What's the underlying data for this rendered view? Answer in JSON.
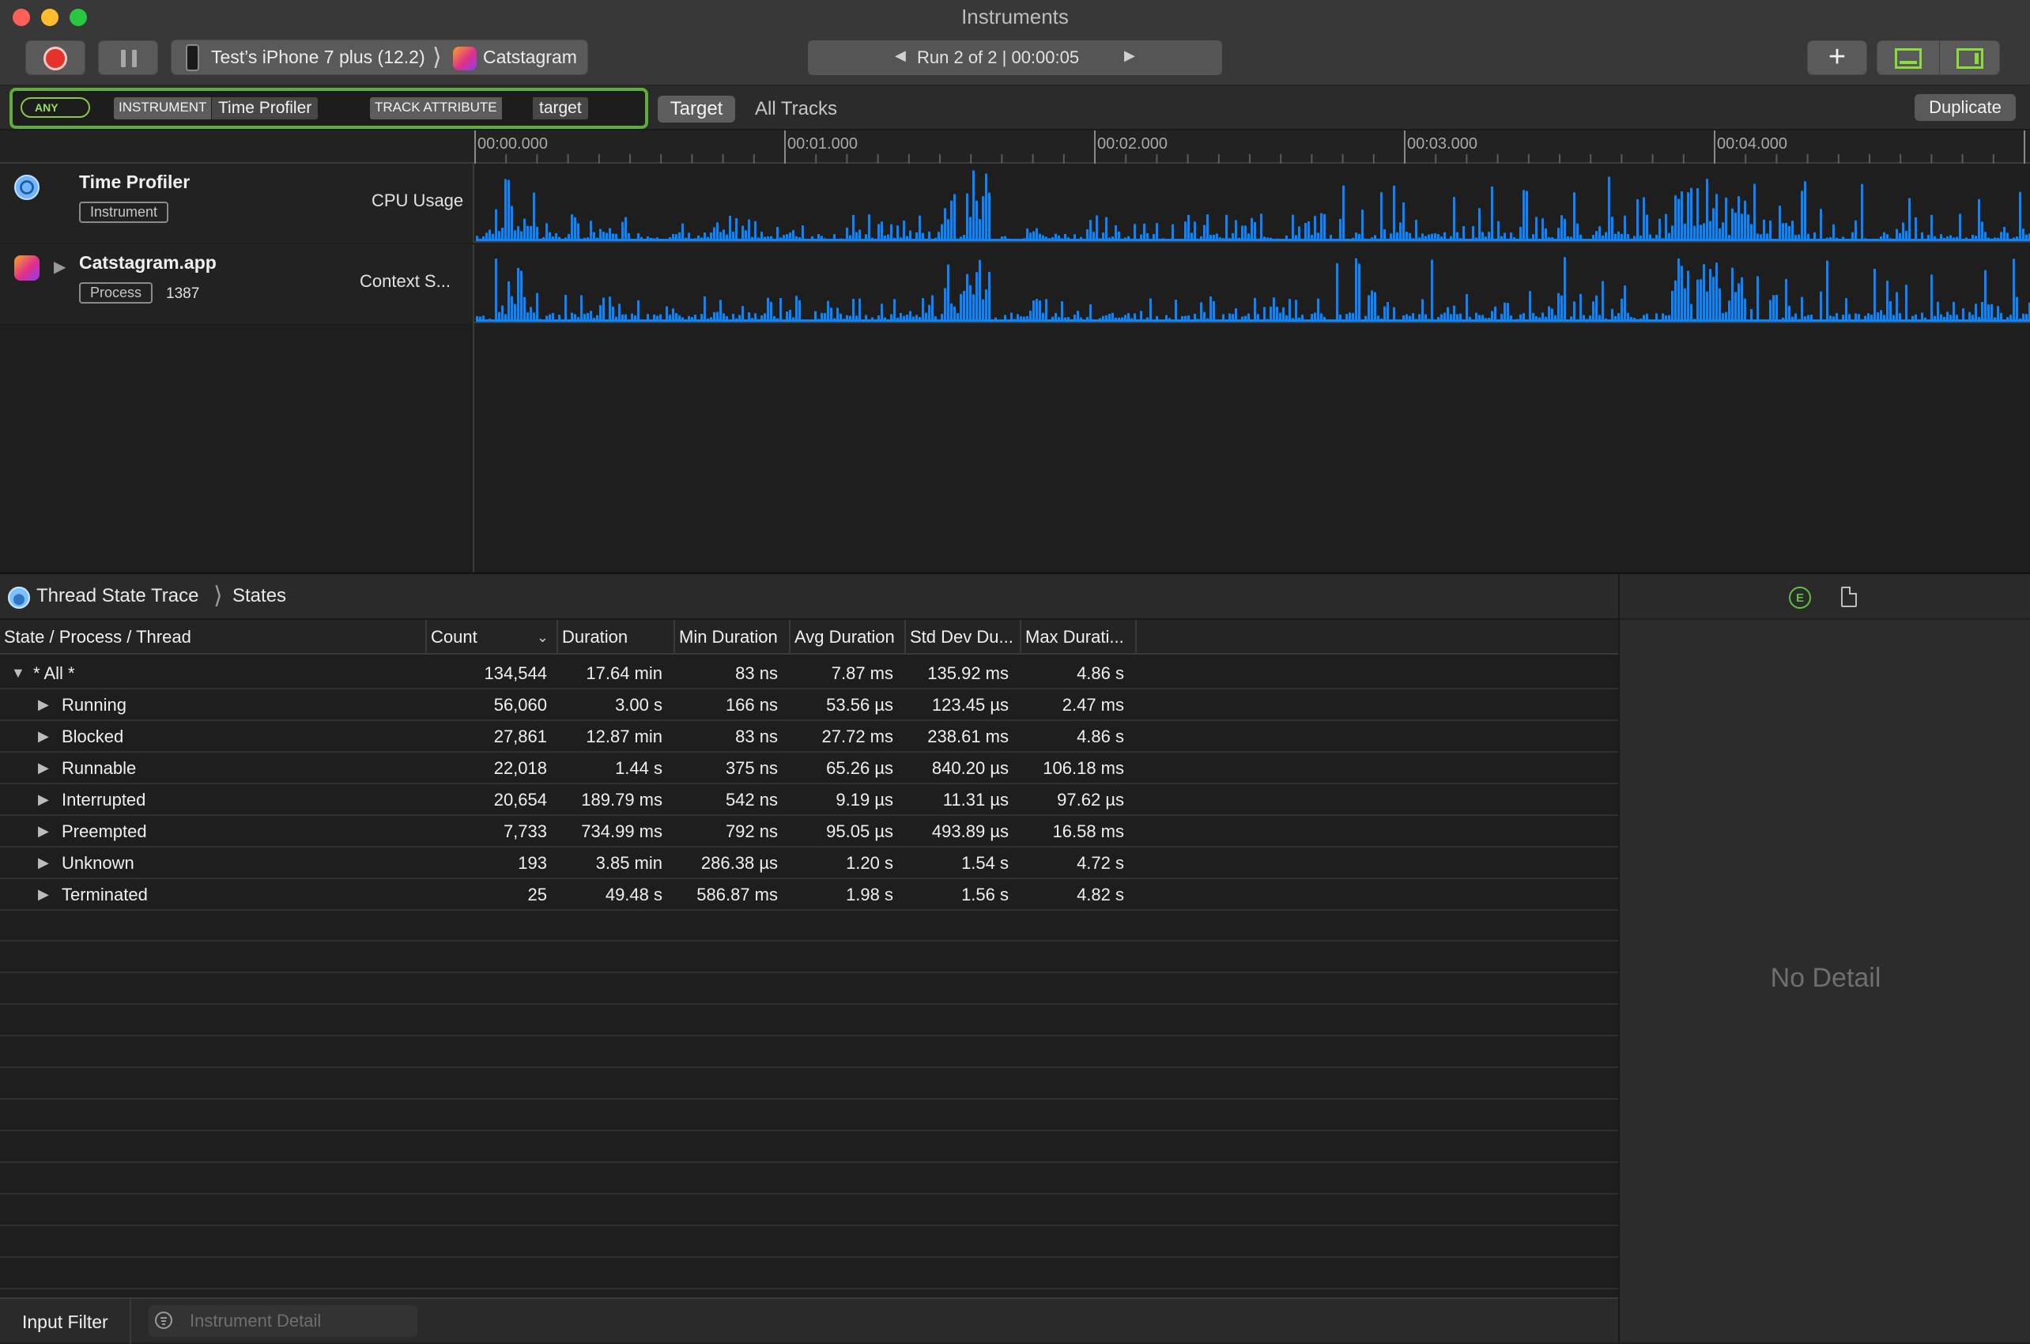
{
  "window": {
    "title": "Instruments"
  },
  "toolbar": {
    "device": "Test’s iPhone 7 plus (12.2)",
    "app": "Catstagram",
    "run_label": "Run 2 of 2  |  00:00:05",
    "icons": {
      "record": "record-stop-icon",
      "pause": "pause-icon",
      "add": "plus-icon",
      "view_bottom": "toggle-bottom-panel-icon",
      "view_right": "toggle-right-panel-icon"
    }
  },
  "filter": {
    "any_label": "ANY",
    "tokens": [
      {
        "key": "INSTRUMENT",
        "value": "Time Profiler"
      },
      {
        "key": "TRACK ATTRIBUTE",
        "value": "target"
      }
    ],
    "target_label": "Target",
    "all_tracks_label": "All Tracks",
    "duplicate_label": "Duplicate"
  },
  "timeline": {
    "ticks": [
      "00:00.000",
      "00:01.000",
      "00:02.000",
      "00:03.000",
      "00:04.000"
    ],
    "tracks": [
      {
        "title": "Time Profiler",
        "badge": "Instrument",
        "extra": "",
        "subtitle": "CPU Usage"
      },
      {
        "title": "Catstagram.app",
        "badge": "Process",
        "extra": "1387",
        "subtitle": "Context S..."
      }
    ],
    "accent_color": "#0a84ff"
  },
  "detail": {
    "instrument": "Thread State Trace",
    "view": "States",
    "columns": [
      "State / Process / Thread",
      "Count",
      "Duration",
      "Min Duration",
      "Avg Duration",
      "Std Dev Du...",
      "Max Durati..."
    ],
    "rows": [
      {
        "name": "* All *",
        "count": "134,544",
        "duration": "17.64 min",
        "min": "83 ns",
        "avg": "7.87 ms",
        "std": "135.92 ms",
        "max": "4.86 s"
      },
      {
        "name": "Running",
        "count": "56,060",
        "duration": "3.00 s",
        "min": "166 ns",
        "avg": "53.56 µs",
        "std": "123.45 µs",
        "max": "2.47 ms"
      },
      {
        "name": "Blocked",
        "count": "27,861",
        "duration": "12.87 min",
        "min": "83 ns",
        "avg": "27.72 ms",
        "std": "238.61 ms",
        "max": "4.86 s"
      },
      {
        "name": "Runnable",
        "count": "22,018",
        "duration": "1.44 s",
        "min": "375 ns",
        "avg": "65.26 µs",
        "std": "840.20 µs",
        "max": "106.18 ms"
      },
      {
        "name": "Interrupted",
        "count": "20,654",
        "duration": "189.79 ms",
        "min": "542 ns",
        "avg": "9.19 µs",
        "std": "11.31 µs",
        "max": "97.62 µs"
      },
      {
        "name": "Preempted",
        "count": "7,733",
        "duration": "734.99 ms",
        "min": "792 ns",
        "avg": "95.05 µs",
        "std": "493.89 µs",
        "max": "16.58 ms"
      },
      {
        "name": "Unknown",
        "count": "193",
        "duration": "3.85 min",
        "min": "286.38 µs",
        "avg": "1.20 s",
        "std": "1.54 s",
        "max": "4.72 s"
      },
      {
        "name": "Terminated",
        "count": "25",
        "duration": "49.48 s",
        "min": "586.87 ms",
        "avg": "1.98 s",
        "std": "1.56 s",
        "max": "4.82 s"
      }
    ],
    "input_filter_label": "Input Filter",
    "instrument_detail_placeholder": "Instrument Detail",
    "no_detail": "No Detail",
    "side_icons": [
      "extended-detail-icon",
      "document-icon"
    ]
  }
}
